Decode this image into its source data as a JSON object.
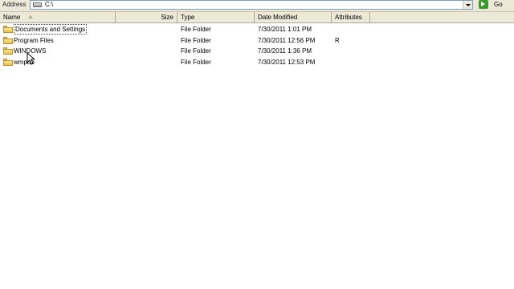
{
  "address_bar": {
    "label": "Address",
    "path": "C:\\",
    "go_label": "Go",
    "drive_icon": "drive-icon",
    "go_icon": "green-arrow-icon"
  },
  "columns": {
    "name": "Name",
    "size": "Size",
    "type": "Type",
    "date_modified": "Date Modified",
    "attributes": "Attributes",
    "sorted_by": "Name"
  },
  "files": [
    {
      "name": "Documents and Settings",
      "size": "",
      "type": "File Folder",
      "date": "7/30/2011 1:01 PM",
      "attributes": "",
      "icon": "folder-icon"
    },
    {
      "name": "Program Files",
      "size": "",
      "type": "File Folder",
      "date": "7/30/2011 12:56 PM",
      "attributes": "R",
      "icon": "folder-icon"
    },
    {
      "name": "WINDOWS",
      "size": "",
      "type": "File Folder",
      "date": "7/30/2011 1:36 PM",
      "attributes": "",
      "icon": "folder-icon"
    },
    {
      "name": "wmpub",
      "size": "",
      "type": "File Folder",
      "date": "7/30/2011 12:53 PM",
      "attributes": "",
      "icon": "folder-icon"
    }
  ],
  "colors": {
    "chrome": "#ece9d8",
    "folder": "#e8c14a",
    "go_green": "#3a9a2f"
  }
}
